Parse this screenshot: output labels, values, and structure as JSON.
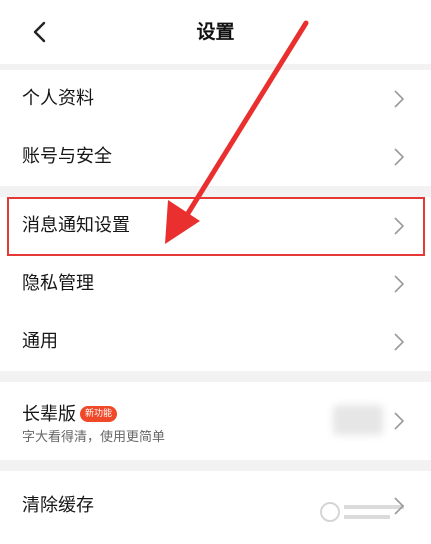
{
  "header": {
    "title": "设置",
    "back_icon": "chevron-left-icon"
  },
  "groups": [
    {
      "items": [
        {
          "label": "个人资料"
        },
        {
          "label": "账号与安全"
        }
      ]
    },
    {
      "items": [
        {
          "label": "消息通知设置",
          "highlighted": true
        },
        {
          "label": "隐私管理"
        },
        {
          "label": "通用"
        }
      ]
    },
    {
      "items": [
        {
          "label": "长辈版",
          "badge": "新功能",
          "sublabel": "字大看得清，使用更简单"
        }
      ]
    },
    {
      "items": [
        {
          "label": "清除缓存"
        }
      ]
    }
  ],
  "colors": {
    "highlight_border": "#e53935",
    "annotation_arrow": "#ea2f2f",
    "badge": "#f0492a"
  }
}
